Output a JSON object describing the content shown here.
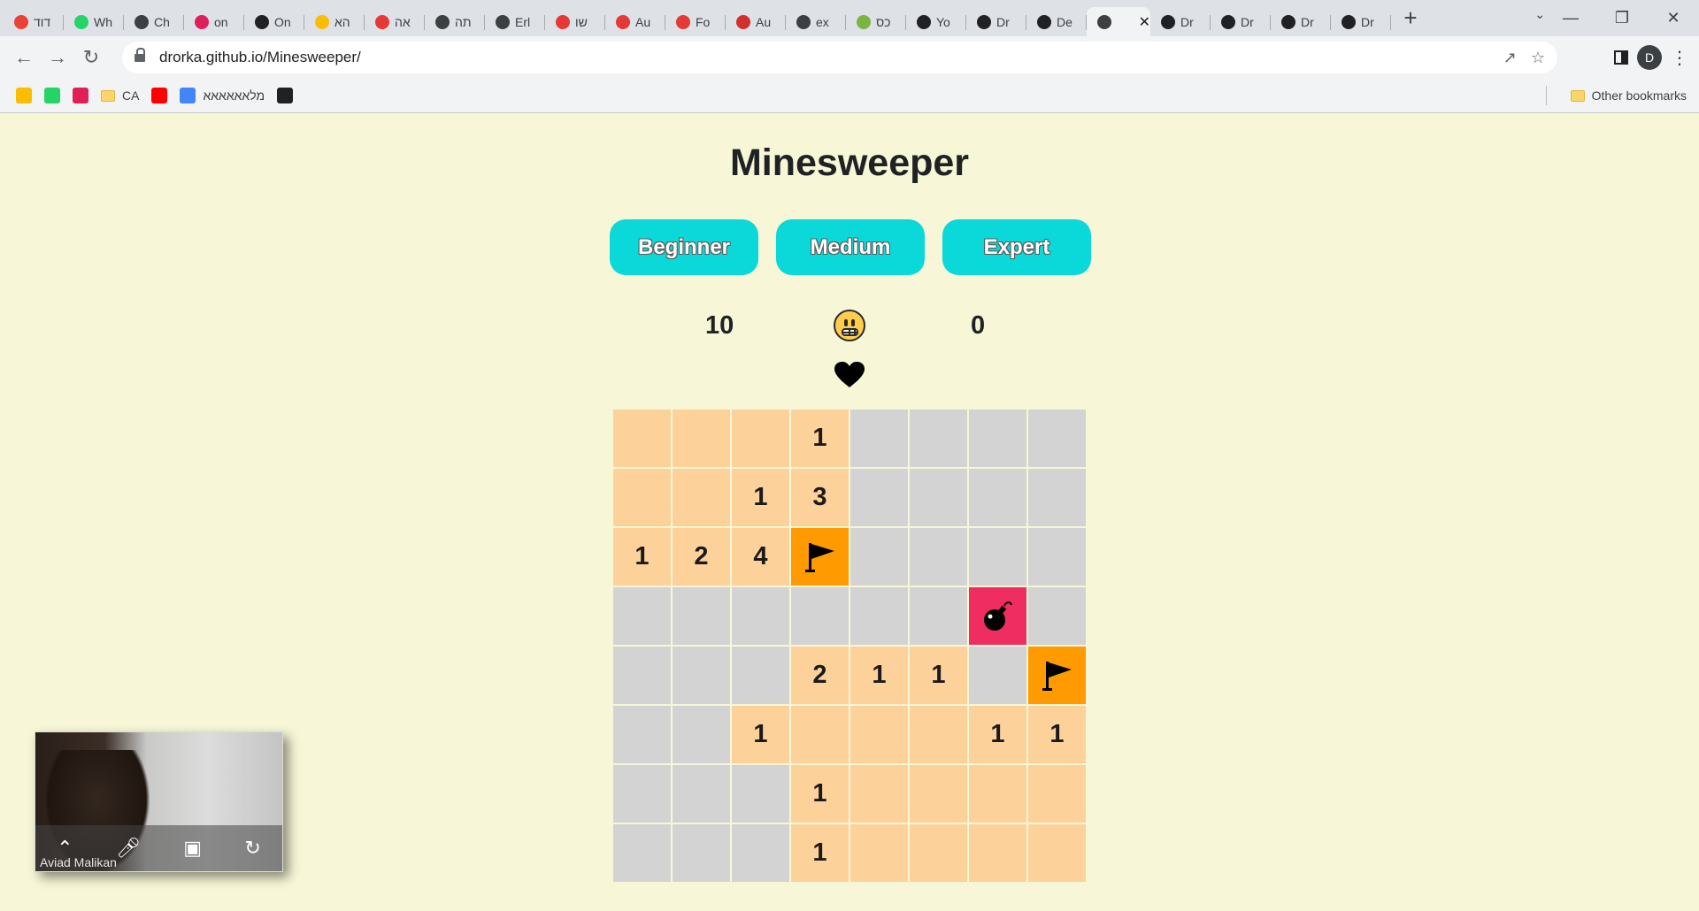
{
  "browser": {
    "tabs": [
      {
        "title": "דוד",
        "icon": "gmail-icon",
        "color": "#ea4335"
      },
      {
        "title": "Wh",
        "icon": "whatsapp-icon",
        "color": "#25d366"
      },
      {
        "title": "Ch",
        "icon": "globe-icon",
        "color": "#3c4043"
      },
      {
        "title": "on",
        "icon": "slack-icon",
        "color": "#e01e5a"
      },
      {
        "title": "On",
        "icon": "github-icon",
        "color": "#202124"
      },
      {
        "title": "הא",
        "icon": "drive-icon",
        "color": "#fbbc04"
      },
      {
        "title": "אה",
        "icon": "hamburger-icon",
        "color": "#e53935"
      },
      {
        "title": "תה",
        "icon": "globe-icon",
        "color": "#3c4043"
      },
      {
        "title": "Erl",
        "icon": "globe-icon",
        "color": "#3c4043"
      },
      {
        "title": "שו",
        "icon": "hamburger-icon",
        "color": "#e53935"
      },
      {
        "title": "Au",
        "icon": "hamburger-icon",
        "color": "#e53935"
      },
      {
        "title": "Fo",
        "icon": "hamburger-icon",
        "color": "#e53935"
      },
      {
        "title": "Au",
        "icon": "flag-at-icon",
        "color": "#d32f2f"
      },
      {
        "title": "ex",
        "icon": "globe-icon",
        "color": "#3c4043"
      },
      {
        "title": "כס",
        "icon": "money-icon",
        "color": "#7cb342"
      },
      {
        "title": "Yo",
        "icon": "github-icon",
        "color": "#202124"
      },
      {
        "title": "Dr",
        "icon": "github-icon",
        "color": "#202124"
      },
      {
        "title": "De",
        "icon": "github-icon",
        "color": "#202124"
      },
      {
        "title": "",
        "icon": "globe-icon",
        "color": "#3c4043",
        "active": true
      },
      {
        "title": "Dr",
        "icon": "github-icon",
        "color": "#202124"
      },
      {
        "title": "Dr",
        "icon": "github-icon",
        "color": "#202124"
      },
      {
        "title": "Dr",
        "icon": "github-icon",
        "color": "#202124"
      },
      {
        "title": "Dr",
        "icon": "github-icon",
        "color": "#202124"
      }
    ],
    "url": "drorka.github.io/Minesweeper/",
    "avatar_letter": "D",
    "bookmarks": [
      {
        "label": "",
        "icon": "drive-icon",
        "color": "#fbbc04"
      },
      {
        "label": "",
        "icon": "whatsapp-icon",
        "color": "#25d366"
      },
      {
        "label": "",
        "icon": "slack-icon",
        "color": "#e01e5a"
      },
      {
        "label": "CA",
        "icon": "folder-icon",
        "color": "#f9d56a"
      },
      {
        "label": "",
        "icon": "youtube-icon",
        "color": "#ff0000"
      },
      {
        "label": "מלאאאאאא",
        "icon": "docs-icon",
        "color": "#4285f4"
      },
      {
        "label": "",
        "icon": "github-icon",
        "color": "#202124"
      }
    ],
    "other_bookmarks": "Other bookmarks"
  },
  "game": {
    "title": "Minesweeper",
    "levels": [
      "Beginner",
      "Medium",
      "Expert"
    ],
    "mines_count": "10",
    "timer": "0",
    "lives": 1,
    "board": [
      [
        "open:",
        "open:",
        "open:",
        "open:1",
        "hidden",
        "hidden",
        "hidden",
        "hidden"
      ],
      [
        "open:",
        "open:",
        "open:1",
        "open:3",
        "hidden",
        "hidden",
        "hidden",
        "hidden"
      ],
      [
        "open:1",
        "open:2",
        "open:4",
        "flag",
        "hidden",
        "hidden",
        "hidden",
        "hidden"
      ],
      [
        "hidden",
        "hidden",
        "hidden",
        "hidden",
        "hidden",
        "hidden",
        "mine",
        "hidden"
      ],
      [
        "hidden",
        "hidden",
        "hidden",
        "open:2",
        "open:1",
        "open:1",
        "hidden",
        "flag"
      ],
      [
        "hidden",
        "hidden",
        "open:1",
        "open:",
        "open:",
        "open:",
        "open:1",
        "open:1"
      ],
      [
        "hidden",
        "hidden",
        "hidden",
        "open:1",
        "open:",
        "open:",
        "open:",
        "open:"
      ],
      [
        "hidden",
        "hidden",
        "hidden",
        "open:1",
        "open:",
        "open:",
        "open:",
        "open:"
      ]
    ],
    "colors": {
      "hidden": "#d3d3d3",
      "open": "#fdd19a",
      "flag": "#ff9a00",
      "mine": "#ef2d61",
      "button": "#0bd8d8"
    }
  },
  "video": {
    "participant": "Aviad Malikan"
  }
}
